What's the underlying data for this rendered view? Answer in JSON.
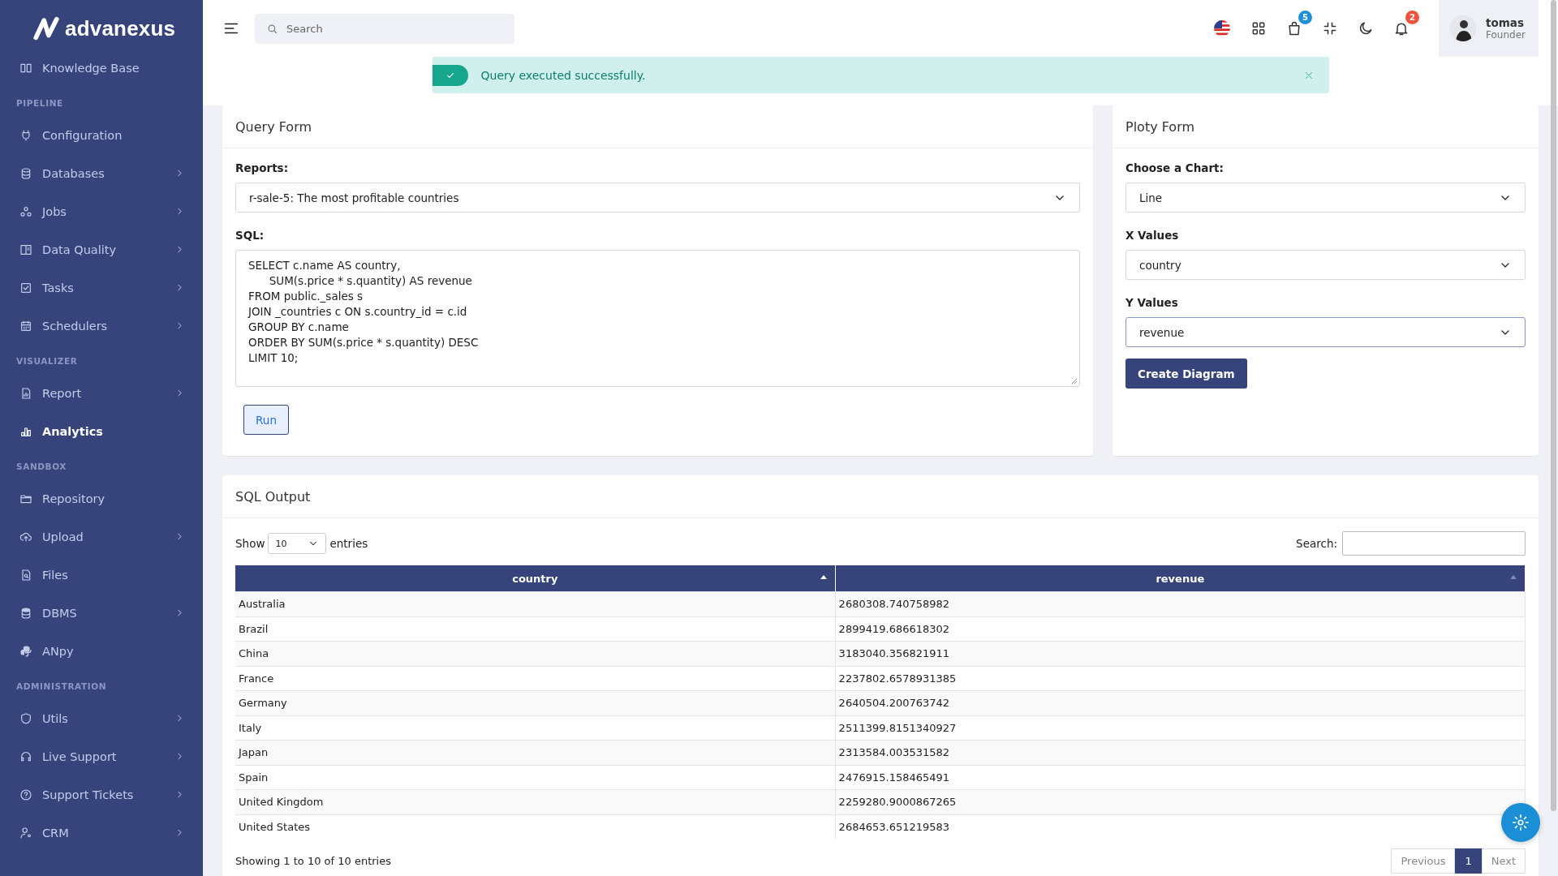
{
  "brand": {
    "name": "advanexus"
  },
  "sidebar": {
    "items": [
      {
        "kind": "item",
        "label": "Knowledge Base",
        "has_submenu": false,
        "selected": false
      },
      {
        "kind": "section",
        "label": "PIPELINE"
      },
      {
        "kind": "item",
        "label": "Configuration",
        "has_submenu": false,
        "selected": false
      },
      {
        "kind": "item",
        "label": "Databases",
        "has_submenu": true,
        "selected": false
      },
      {
        "kind": "item",
        "label": "Jobs",
        "has_submenu": true,
        "selected": false
      },
      {
        "kind": "item",
        "label": "Data Quality",
        "has_submenu": true,
        "selected": false
      },
      {
        "kind": "item",
        "label": "Tasks",
        "has_submenu": true,
        "selected": false
      },
      {
        "kind": "item",
        "label": "Schedulers",
        "has_submenu": true,
        "selected": false
      },
      {
        "kind": "section",
        "label": "VISUALIZER"
      },
      {
        "kind": "item",
        "label": "Report",
        "has_submenu": true,
        "selected": false
      },
      {
        "kind": "item",
        "label": "Analytics",
        "has_submenu": false,
        "selected": true
      },
      {
        "kind": "section",
        "label": "SANDBOX"
      },
      {
        "kind": "item",
        "label": "Repository",
        "has_submenu": false,
        "selected": false
      },
      {
        "kind": "item",
        "label": "Upload",
        "has_submenu": true,
        "selected": false
      },
      {
        "kind": "item",
        "label": "Files",
        "has_submenu": false,
        "selected": false
      },
      {
        "kind": "item",
        "label": "DBMS",
        "has_submenu": true,
        "selected": false
      },
      {
        "kind": "item",
        "label": "ANpy",
        "has_submenu": false,
        "selected": false
      },
      {
        "kind": "section",
        "label": "ADMINISTRATION"
      },
      {
        "kind": "item",
        "label": "Utils",
        "has_submenu": true,
        "selected": false
      },
      {
        "kind": "item",
        "label": "Live Support",
        "has_submenu": true,
        "selected": false
      },
      {
        "kind": "item",
        "label": "Support Tickets",
        "has_submenu": true,
        "selected": false
      },
      {
        "kind": "item",
        "label": "CRM",
        "has_submenu": true,
        "selected": false
      }
    ]
  },
  "topbar": {
    "search": {
      "placeholder": "Search"
    },
    "cart_badge": "5",
    "notifications_badge": "2",
    "user": {
      "name": "tomas",
      "role": "Founder"
    }
  },
  "alert": {
    "message": "Query executed successfully."
  },
  "query_form": {
    "title": "Query Form",
    "reports_label": "Reports:",
    "report_value": "r-sale-5: The most profitable countries",
    "sql_label": "SQL:",
    "sql": "SELECT c.name AS country,\n      SUM(s.price * s.quantity) AS revenue\nFROM public._sales s\nJOIN _countries c ON s.country_id = c.id\nGROUP BY c.name\nORDER BY SUM(s.price * s.quantity) DESC\nLIMIT 10;",
    "run_button": "Run"
  },
  "ploty_form": {
    "title": "Ploty Form",
    "fields": [
      {
        "label": "Choose a Chart:",
        "value": "Line",
        "focused": false
      },
      {
        "label": "X Values",
        "value": "country",
        "focused": false
      },
      {
        "label": "Y Values",
        "value": "revenue",
        "focused": true
      }
    ],
    "button": "Create Diagram"
  },
  "sql_output": {
    "title": "SQL Output",
    "show_label": "Show",
    "page_size": "10",
    "entries_label": "entries",
    "search_label": "Search:",
    "columns": [
      {
        "label": "country",
        "sorted": true
      },
      {
        "label": "revenue",
        "sorted": false
      }
    ],
    "rows": [
      [
        "Australia",
        "2680308.740758982"
      ],
      [
        "Brazil",
        "2899419.686618302"
      ],
      [
        "China",
        "3183040.356821911"
      ],
      [
        "France",
        "2237802.6578931385"
      ],
      [
        "Germany",
        "2640504.200763742"
      ],
      [
        "Italy",
        "2511399.8151340927"
      ],
      [
        "Japan",
        "2313584.003531582"
      ],
      [
        "Spain",
        "2476915.158465491"
      ],
      [
        "United Kingdom",
        "2259280.9000867265"
      ],
      [
        "United States",
        "2684653.651219583"
      ]
    ],
    "summary": "Showing 1 to 10 of 10 entries",
    "pages": [
      {
        "label": "Previous",
        "selected": false
      },
      {
        "label": "1",
        "selected": true
      },
      {
        "label": "Next",
        "selected": false
      }
    ]
  }
}
